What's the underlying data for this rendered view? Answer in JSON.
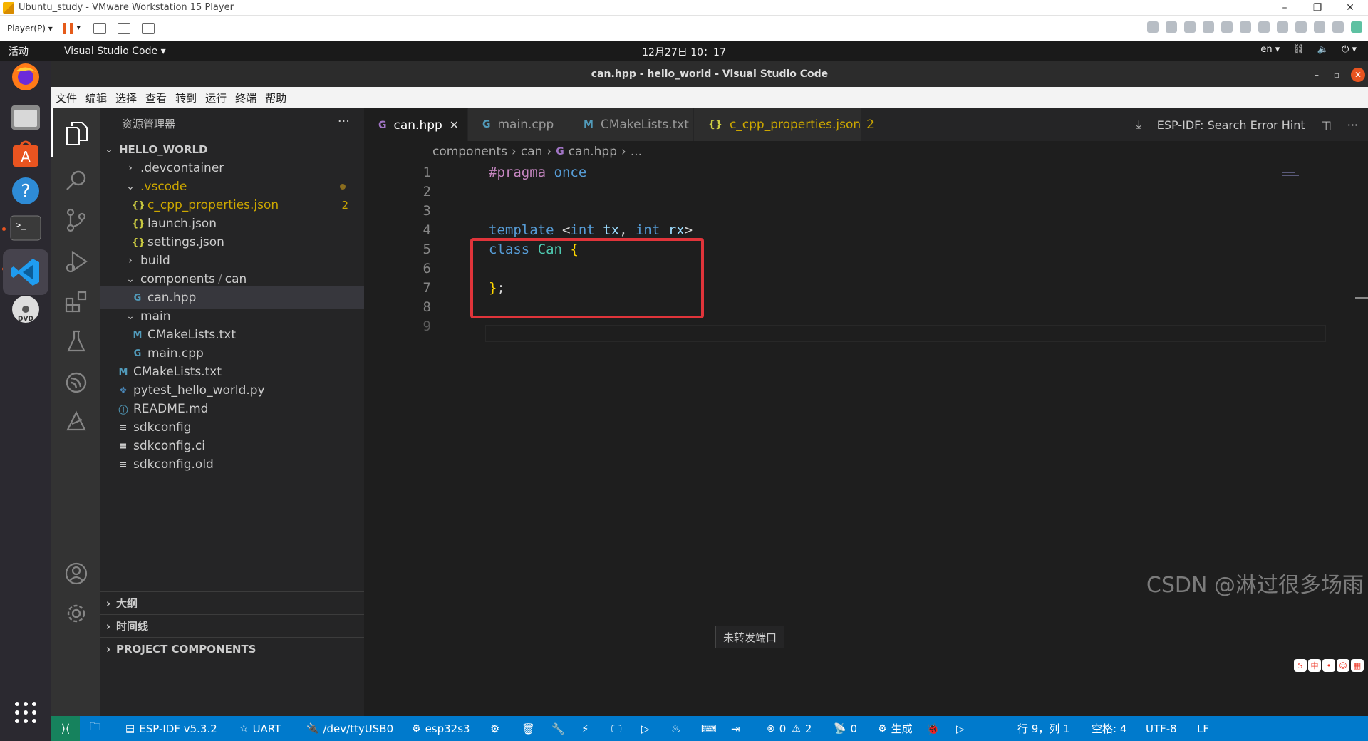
{
  "vmware": {
    "title": "Ubuntu_study - VMware Workstation 15 Player",
    "player_menu": "Player(P)"
  },
  "gnome": {
    "activities": "活动",
    "app_menu": "Visual Studio Code",
    "clock": "12月27日 10：17",
    "lang": "en"
  },
  "vscode": {
    "title": "can.hpp - hello_world - Visual Studio Code",
    "menu": [
      "文件",
      "编辑",
      "选择",
      "查看",
      "转到",
      "运行",
      "终端",
      "帮助"
    ],
    "explorer_title": "资源管理器",
    "workspace": "HELLO_WORLD",
    "tree": [
      {
        "label": ".devcontainer",
        "type": "folder",
        "open": false
      },
      {
        "label": ".vscode",
        "type": "folder",
        "open": true,
        "modified": true
      },
      {
        "label": "c_cpp_properties.json",
        "type": "json",
        "badge": "2",
        "warn": true
      },
      {
        "label": "launch.json",
        "type": "json"
      },
      {
        "label": "settings.json",
        "type": "json"
      },
      {
        "label": "build",
        "type": "folder",
        "open": false
      },
      {
        "label": "components",
        "label2": "can",
        "type": "folder",
        "open": true
      },
      {
        "label": "can.hpp",
        "type": "cpp",
        "selected": true
      },
      {
        "label": "main",
        "type": "folder",
        "open": true
      },
      {
        "label": "CMakeLists.txt",
        "type": "cmake"
      },
      {
        "label": "main.cpp",
        "type": "cpp"
      },
      {
        "label": "CMakeLists.txt",
        "type": "cmake"
      },
      {
        "label": "pytest_hello_world.py",
        "type": "py"
      },
      {
        "label": "README.md",
        "type": "info"
      },
      {
        "label": "sdkconfig",
        "type": "text"
      },
      {
        "label": "sdkconfig.ci",
        "type": "text"
      },
      {
        "label": "sdkconfig.old",
        "type": "text"
      }
    ],
    "sections": [
      "大纲",
      "时间线",
      "PROJECT COMPONENTS"
    ],
    "tabs": [
      {
        "label": "can.hpp",
        "icon": "C",
        "active": true
      },
      {
        "label": "main.cpp",
        "icon": "C"
      },
      {
        "label": "CMakeLists.txt",
        "icon": "M"
      },
      {
        "label": "c_cpp_properties.json",
        "icon": "{}",
        "badge": "2",
        "warn": true
      }
    ],
    "tab_action": "ESP-IDF: Search Error Hint",
    "breadcrumb": [
      "components",
      "can",
      "can.hpp",
      "..."
    ],
    "code_lines": [
      "1",
      "2",
      "3",
      "4",
      "5",
      "6",
      "7",
      "8",
      "9"
    ],
    "tooltip": "未转发端口",
    "status": {
      "idf": "ESP-IDF v5.3.2",
      "uart": "UART",
      "port": "/dev/ttyUSB0",
      "target": "esp32s3",
      "errors": "0",
      "warnings": "2",
      "ports": "0",
      "build": "生成",
      "position": "行 9，列 1",
      "spaces": "空格: 4",
      "encoding": "UTF-8",
      "eol": "LF"
    }
  },
  "watermark": "CSDN @淋过很多场雨"
}
